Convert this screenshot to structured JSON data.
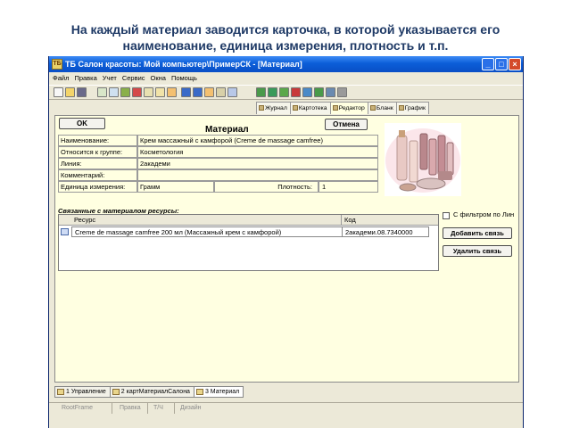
{
  "caption": {
    "line1": "На каждый материал заводится карточка, в которой указывается его",
    "line2": "наименование, единица измерения, плотность и т.п."
  },
  "window": {
    "title": "ТБ Салон красоты: Мой компьютер\\ПримерСК - [Материал]",
    "app_icon": "ТБ",
    "min_btn": "_",
    "max_btn": "□",
    "close_btn": "×"
  },
  "menu": [
    "Файл",
    "Правка",
    "Учет",
    "Сервис",
    "Окна",
    "Помощь"
  ],
  "top_tabs": [
    "Журнал",
    "Картотека",
    "Редактор",
    "Бланк",
    "График"
  ],
  "form": {
    "title": "Материал",
    "ok": "OK",
    "cancel": "Отмена",
    "fields": [
      {
        "label": "Наименование:",
        "value": "Крем массажный с камфорой (Creme de massage camfree)"
      },
      {
        "label": "Относится к группе:",
        "value": "Косметология"
      },
      {
        "label": "Линия:",
        "value": "2академи"
      },
      {
        "label": "Комментарий:",
        "value": ""
      },
      {
        "label": "Единица измерения:",
        "value": "Грамм"
      }
    ],
    "density_label": "Плотность:",
    "density_value": "1"
  },
  "resources": {
    "title": "Связанные с материалом ресурсы:",
    "columns": [
      "Ресурс",
      "Код"
    ],
    "rows": [
      {
        "resource": "Creme de massage camfree 200 мл (Массажный крем с камфорой)",
        "code": "2академи.08.7340000"
      }
    ],
    "filter_label": "С фильтром по Лин",
    "add_button": "Добавить связь",
    "remove_button": "Удалить связь"
  },
  "bottom_tabs": [
    "1 Управление",
    "2 картМатериалСалона",
    "3 Материал"
  ],
  "status": [
    "RootFrame",
    "Правка",
    "Т/Ч",
    "Дизайн"
  ],
  "colors": {
    "panel_bg": "#ffffe1",
    "title_bar": "#0b5ed8",
    "caption_text": "#1f3a66"
  }
}
